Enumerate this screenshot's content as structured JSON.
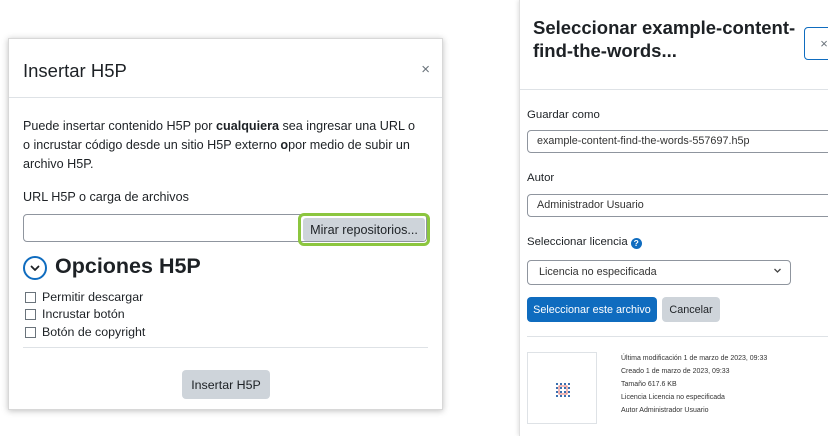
{
  "left_dialog": {
    "title": "Insertar H5P",
    "close_glyph": "×",
    "intro_pre": "Puede insertar contenido H5P por ",
    "intro_bold1": "cualquiera",
    "intro_mid": " sea ingresar una URL o o incrustar código desde un sitio H5P externo ",
    "intro_bold2": "o",
    "intro_post": "por medio de subir un archivo H5P.",
    "url_label": "URL H5P o carga de archivos",
    "url_value": "",
    "repo_button": "Mirar repositorios...",
    "options_title": "Opciones H5P",
    "checkboxes": [
      "Permitir descargar",
      "Incrustar botón",
      "Botón de copyright"
    ],
    "insert_button": "Insertar H5P",
    "highlight_color": "#8cc63f"
  },
  "right_dialog": {
    "title": "Seleccionar example-content-find-the-words...",
    "close_glyph": "×",
    "save_as_label": "Guardar como",
    "save_as_value": "example-content-find-the-words-557697.h5p",
    "author_label": "Autor",
    "author_value": "Administrador Usuario",
    "license_label": "Seleccionar licencia",
    "license_value": "Licencia no especificada",
    "select_button": "Seleccionar este archivo",
    "cancel_button": "Cancelar",
    "file_info": [
      "Última modificación  1 de marzo de 2023, 09:33",
      "Creado  1 de marzo de 2023, 09:33",
      "Tamaño  617.6 KB",
      "Licencia  Licencia no especificada",
      "Autor  Administrador Usuario"
    ],
    "primary_color": "#0f6cbf"
  }
}
